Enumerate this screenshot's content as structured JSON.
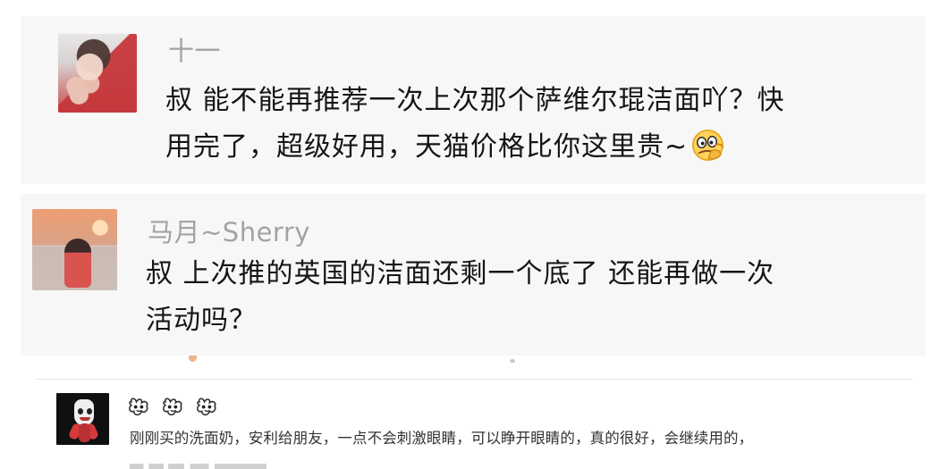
{
  "comments": [
    {
      "user": "十一",
      "lines": [
        "叔 能不能再推荐一次上次那个萨维尔琨洁面吖？快",
        "用完了，超级好用，天猫价格比你这里贵~"
      ],
      "emoji": "thinking-emoji-icon",
      "background": "#f7f7f7"
    },
    {
      "user": "马月~Sherry",
      "lines": [
        "叔 上次推的英国的洁面还剩一个底了 还能再做一次",
        "活动吗？"
      ],
      "background": "#f7f7f7"
    },
    {
      "name_icons": [
        "bunny-mask-icon",
        "bunny-mask-icon",
        "bunny-mask-icon"
      ],
      "text": "刚刚买的洗面奶，安利给朋友，一点不会刺激眼睛，可以睁开眼睛的，真的很好，会继续用的，"
    }
  ],
  "colors": {
    "name_gray": "#a3a3a3",
    "text_black": "#151515",
    "card_background": "#f7f7f7",
    "divider": "#e6e6e6"
  }
}
